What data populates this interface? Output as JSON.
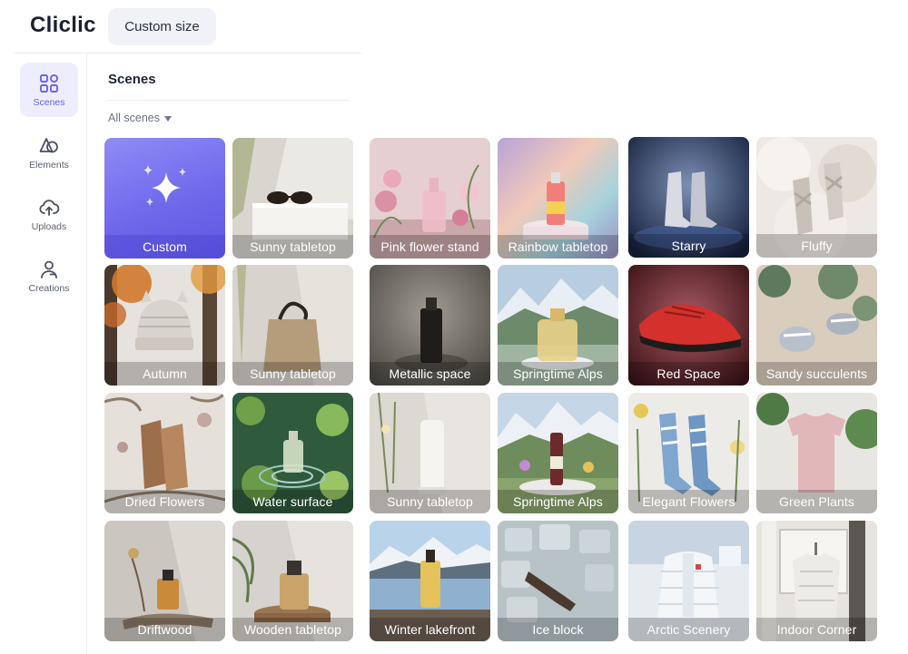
{
  "app": {
    "logo_text": "Cliclic"
  },
  "toolbar": {
    "custom_size_label": "Custom size"
  },
  "sidebar": {
    "items": [
      {
        "label": "Scenes",
        "icon": "grid-icon",
        "active": true
      },
      {
        "label": "Elements",
        "icon": "shapes-icon",
        "active": false
      },
      {
        "label": "Uploads",
        "icon": "cloud-upload-icon",
        "active": false
      },
      {
        "label": "Creations",
        "icon": "user-icon",
        "active": false
      }
    ]
  },
  "panel": {
    "title": "Scenes",
    "filter_label": "All scenes"
  },
  "accent_color": "#6c66ea",
  "scenes": [
    {
      "label": "Custom",
      "icon": "sparkle-icon"
    },
    {
      "label": "Sunny tabletop"
    },
    {
      "label": "Pink flower stand"
    },
    {
      "label": "Rainbow tabletop"
    },
    {
      "label": "Starry"
    },
    {
      "label": "Fluffy"
    },
    {
      "label": "Autumn"
    },
    {
      "label": "Sunny tabletop"
    },
    {
      "label": "Metallic space"
    },
    {
      "label": "Springtime Alps"
    },
    {
      "label": "Red Space"
    },
    {
      "label": "Sandy succulents"
    },
    {
      "label": "Dried Flowers"
    },
    {
      "label": "Water surface"
    },
    {
      "label": "Sunny tabletop"
    },
    {
      "label": "Springtime Alps"
    },
    {
      "label": "Elegant Flowers"
    },
    {
      "label": "Green Plants"
    },
    {
      "label": "Driftwood"
    },
    {
      "label": "Wooden tabletop"
    },
    {
      "label": "Winter lakefront"
    },
    {
      "label": "Ice block"
    },
    {
      "label": "Arctic Scenery"
    },
    {
      "label": "Indoor Corner"
    }
  ]
}
